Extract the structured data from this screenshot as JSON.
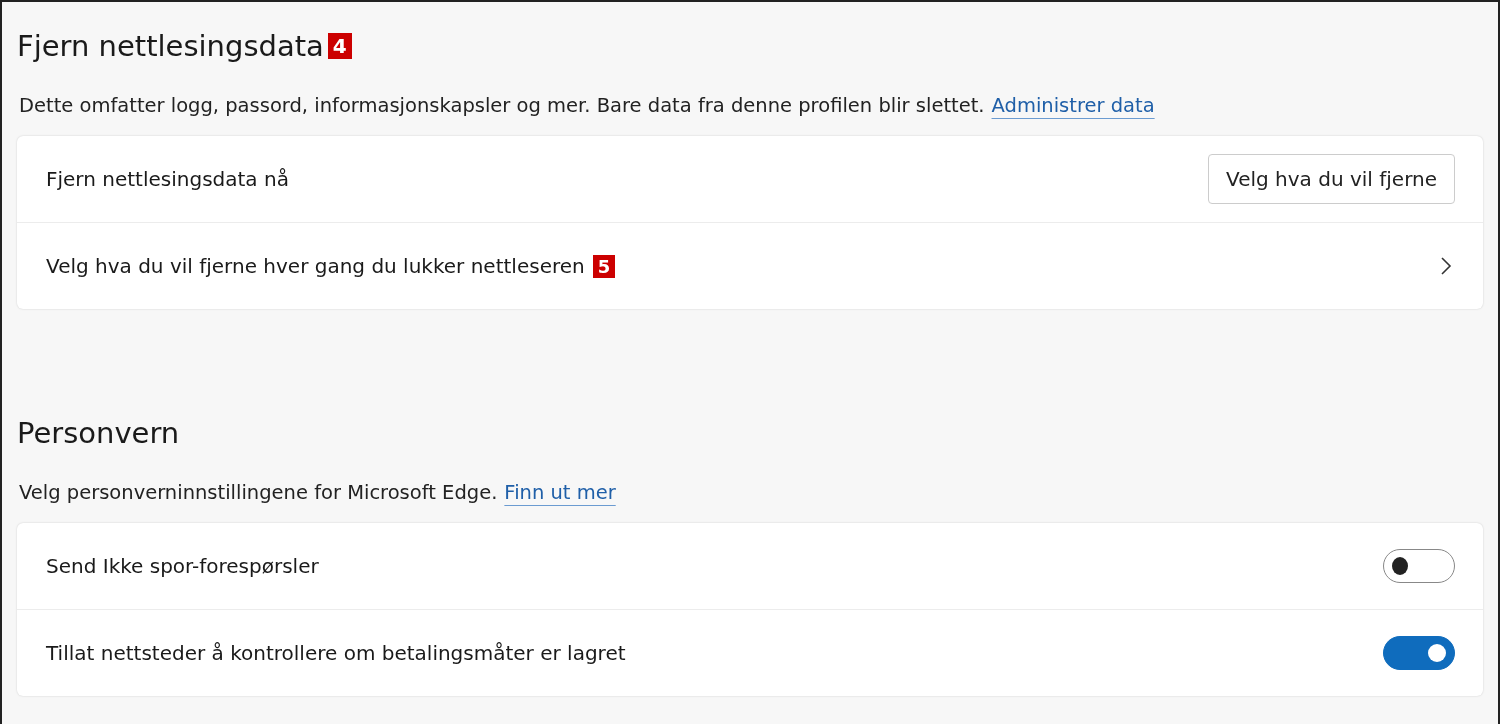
{
  "sections": [
    {
      "title": "Fjern nettlesingsdata",
      "badge": "4",
      "description": "Dette omfatter logg, passord, informasjonskapsler og mer. Bare data fra denne profilen blir slettet.",
      "link": "Administrer data",
      "rows": [
        {
          "kind": "button",
          "label": "Fjern nettlesingsdata nå",
          "button": "Velg hva du vil fjerne"
        },
        {
          "kind": "chevron",
          "label": "Velg hva du vil fjerne hver gang du lukker nettleseren",
          "badge": "5"
        }
      ]
    },
    {
      "title": "Personvern",
      "description": "Velg personverninnstillingene for Microsoft Edge.",
      "link": "Finn ut mer",
      "rows": [
        {
          "kind": "toggle",
          "label": "Send Ikke spor-forespørsler",
          "on": false
        },
        {
          "kind": "toggle",
          "label": "Tillat nettsteder å kontrollere om betalingsmåter er lagret",
          "on": true
        }
      ]
    }
  ]
}
